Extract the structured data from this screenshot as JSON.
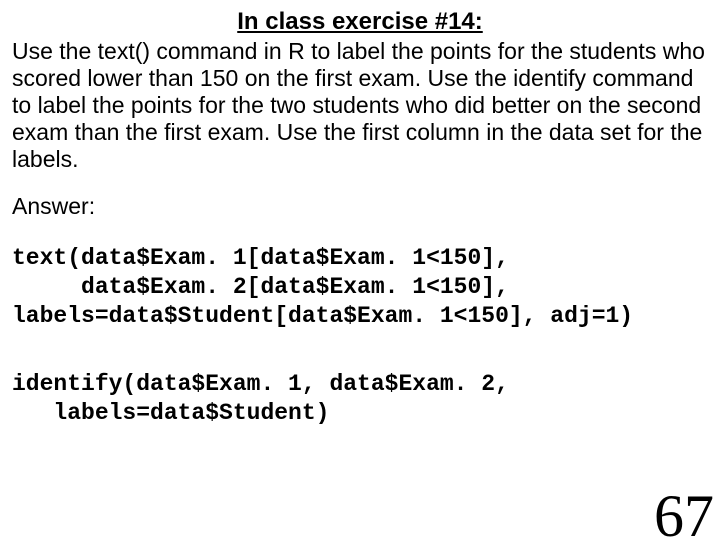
{
  "title": "In class exercise #14:",
  "paragraph": "Use the text() command in R to label the points for the students who scored lower than 150 on the first exam.  Use the identify command to label the points for the two students who did better on the second exam than the first exam.  Use the first column in the data set for the labels.",
  "answer_label": "Answer:",
  "code_block_1": "text(data$Exam. 1[data$Exam. 1<150],\n     data$Exam. 2[data$Exam. 1<150],\nlabels=data$Student[data$Exam. 1<150], adj=1)",
  "code_block_2": "identify(data$Exam. 1, data$Exam. 2,\n   labels=data$Student)",
  "page_number": "67"
}
